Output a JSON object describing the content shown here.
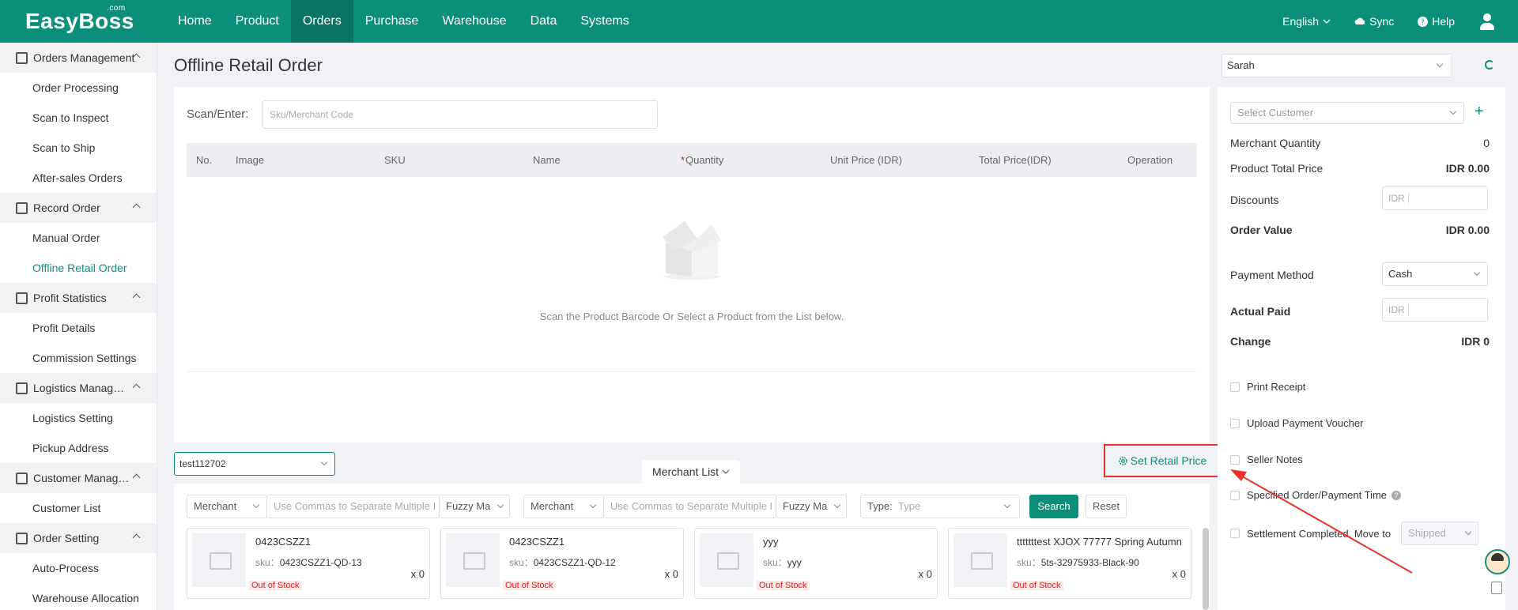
{
  "app": {
    "logo": "EasyBoss",
    "logo_sup": ".com"
  },
  "topnav": {
    "items": [
      "Home",
      "Product",
      "Orders",
      "Purchase",
      "Warehouse",
      "Data",
      "Systems"
    ],
    "active": "Orders",
    "language": "English",
    "sync": "Sync",
    "help": "Help"
  },
  "sidebar": {
    "groups": [
      {
        "label": "Orders Management",
        "items": [
          "Order Processing",
          "Scan to Inspect",
          "Scan to Ship",
          "After-sales Orders"
        ]
      },
      {
        "label": "Record Order",
        "items": [
          "Manual Order",
          "Offline Retail Order"
        ]
      },
      {
        "label": "Profit Statistics",
        "items": [
          "Profit Details",
          "Commission Settings"
        ]
      },
      {
        "label": "Logistics Management",
        "items": [
          "Logistics Setting",
          "Pickup Address"
        ]
      },
      {
        "label": "Customer Management",
        "items": [
          "Customer List"
        ]
      },
      {
        "label": "Order Setting",
        "items": [
          "Auto-Process",
          "Warehouse Allocation"
        ]
      }
    ],
    "active_item": "Offline Retail Order"
  },
  "page": {
    "title": "Offline Retail Order"
  },
  "scan": {
    "label": "Scan/Enter:",
    "placeholder": "Sku/Merchant Code"
  },
  "table": {
    "columns": [
      "No.",
      "Image",
      "SKU",
      "Name",
      "*",
      "Quantity",
      "Unit Price (IDR)",
      "Total Price(IDR)",
      "Operation"
    ],
    "empty_text": "Scan the Product Barcode Or Select a Product from the List below."
  },
  "bottom": {
    "store": "test112702",
    "merchant_tab": "Merchant List",
    "set_retail_price": "Set Retail Price",
    "filters": {
      "merchant_1": "Merchant",
      "input_1_placeholder": "Use Commas to Separate Multiple I",
      "match_1": "Fuzzy Ma",
      "merchant_2": "Merchant",
      "input_2_placeholder": "Use Commas to Separate Multiple I",
      "match_2": "Fuzzy Ma",
      "type_label": "Type:",
      "type_placeholder": "Type",
      "search": "Search",
      "reset": "Reset"
    },
    "products": [
      {
        "name": "0423CSZZ1",
        "sku_label": "sku：",
        "sku": "0423CSZZ1-QD-13",
        "qty": "x 0",
        "status": "Out of Stock"
      },
      {
        "name": "0423CSZZ1",
        "sku_label": "sku：",
        "sku": "0423CSZZ1-QD-12",
        "qty": "x 0",
        "status": "Out of Stock"
      },
      {
        "name": "yyy",
        "sku_label": "sku：",
        "sku": "yyy",
        "qty": "x 0",
        "status": "Out of Stock"
      },
      {
        "name": "tttttttest XJOX 77777 Spring Autumn",
        "sku_label": "sku：",
        "sku": "5ts-32975933-Black-90",
        "qty": "x 0",
        "status": "Out of Stock"
      }
    ]
  },
  "right": {
    "user": "Sarah",
    "customer_placeholder": "Select  Customer",
    "merchant_quantity_label": "Merchant Quantity",
    "merchant_quantity": "0",
    "product_total_label": "Product Total Price",
    "product_total": "IDR 0.00",
    "discounts_label": "Discounts",
    "idr_prefix": "IDR",
    "order_value_label": "Order Value",
    "order_value": "IDR 0.00",
    "payment_method_label": "Payment Method",
    "payment_method": "Cash",
    "actual_paid_label": "Actual Paid",
    "change_label": "Change",
    "change": "IDR 0",
    "options": {
      "print_receipt": "Print Receipt",
      "upload_voucher": "Upload Payment Voucher",
      "seller_notes": "Seller Notes",
      "specified_time": "Specified Order/Payment Time",
      "settlement": "Settlement Completed, Move to",
      "settlement_target": "Shipped"
    }
  },
  "colors": {
    "brand": "#0b8f7a",
    "highlight": "#e8322c"
  }
}
